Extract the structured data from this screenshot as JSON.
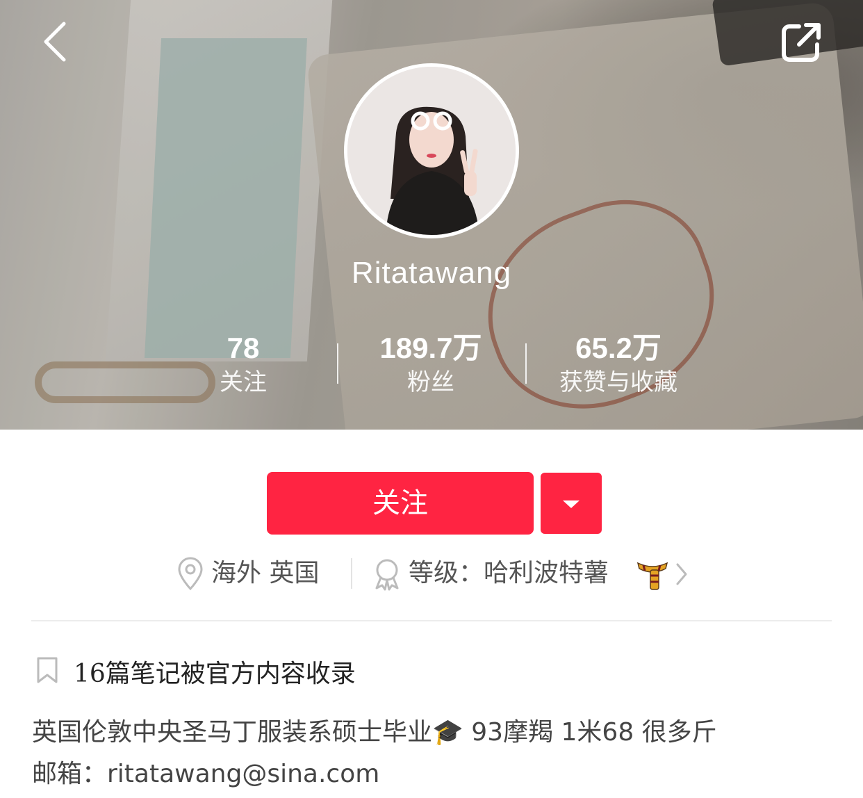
{
  "header": {
    "username": "Ritatawang",
    "stats": [
      {
        "value": "78",
        "label": "关注"
      },
      {
        "value": "189.7万",
        "label": "粉丝"
      },
      {
        "value": "65.2万",
        "label": "获赞与收藏"
      }
    ]
  },
  "actions": {
    "follow_label": "关注"
  },
  "info": {
    "location": "海外 英国",
    "level": "等级：哈利波特薯"
  },
  "collected": {
    "text": "16篇笔记被官方内容收录"
  },
  "bio": {
    "line1": "英国伦敦中央圣马丁服装系硕士毕业🎓  93摩羯 1米68 很多斤",
    "line2": "邮箱：ritatawang@sina.com"
  },
  "colors": {
    "accent": "#ff2442",
    "text_primary": "#222222",
    "text_secondary": "#555555"
  },
  "icons": {
    "back": "chevron-left-icon",
    "share": "share-icon",
    "dropdown": "caret-down-icon",
    "location": "location-pin-icon",
    "level": "badge-icon",
    "scarf": "scarf-icon",
    "chevron": "chevron-right-icon",
    "bookmark": "bookmark-icon"
  }
}
